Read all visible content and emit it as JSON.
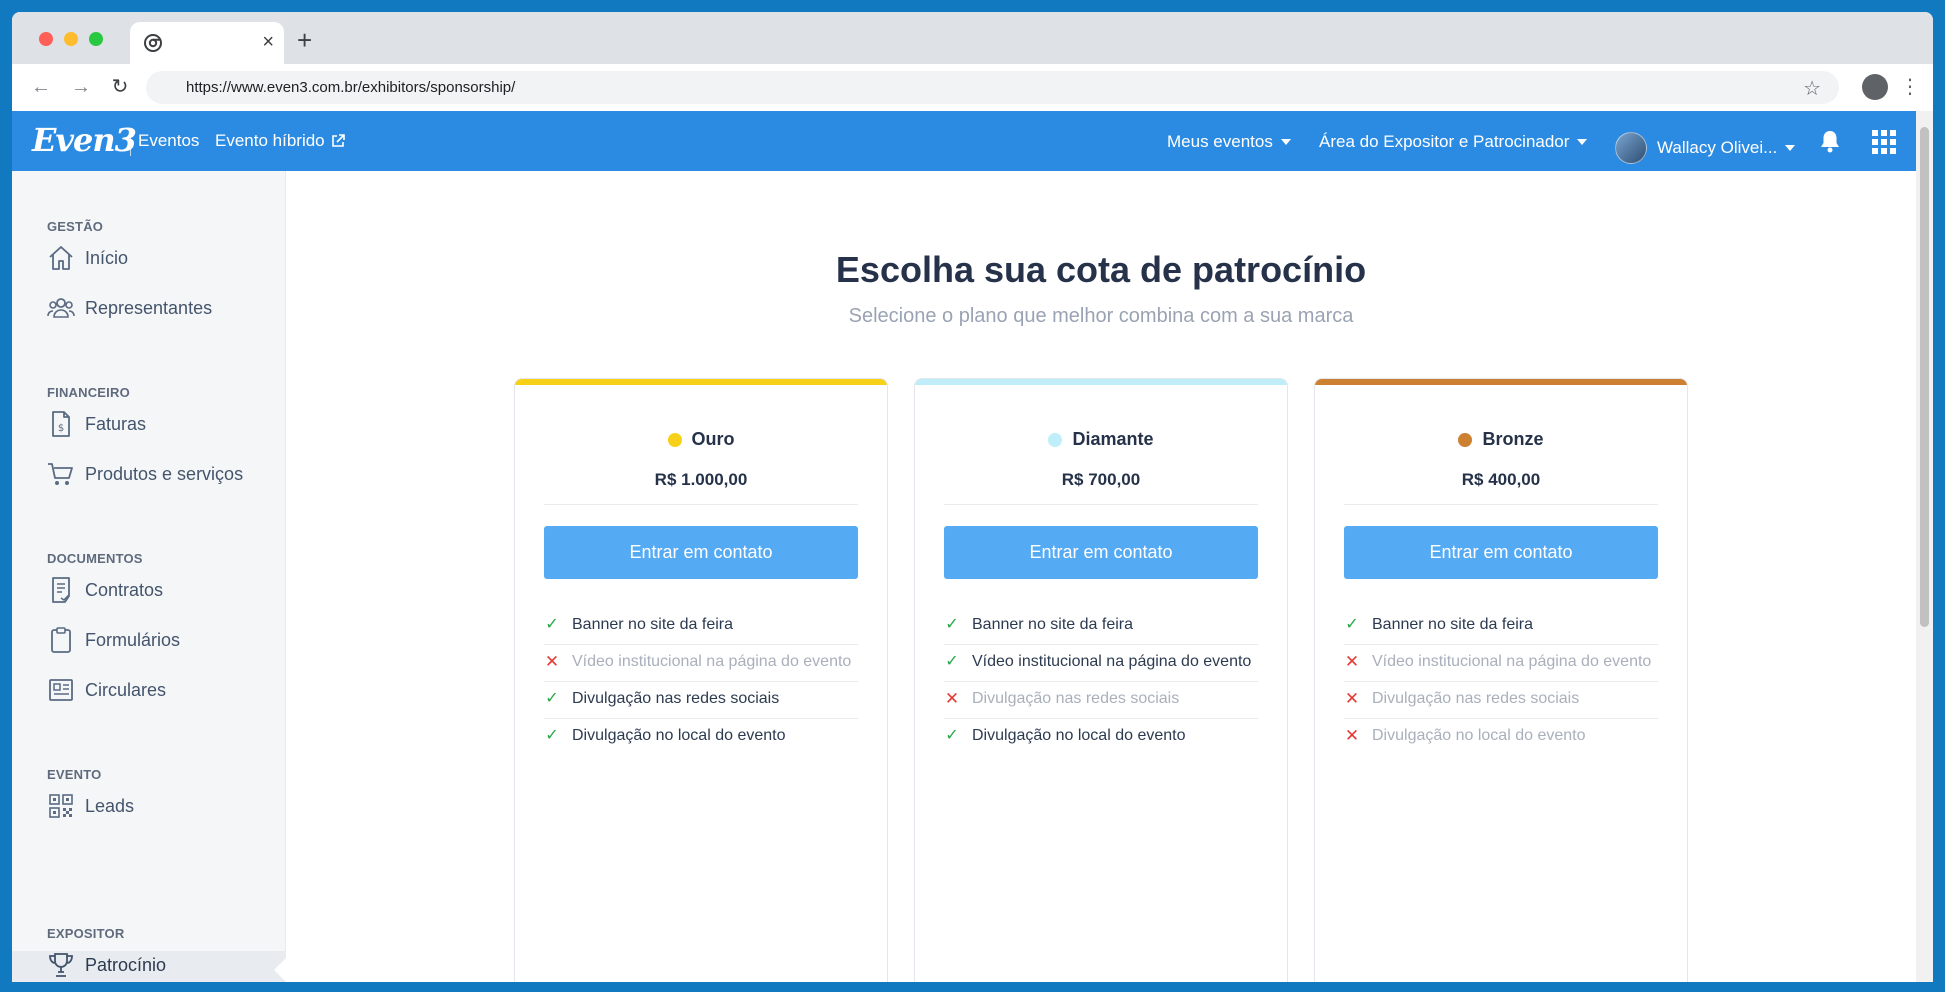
{
  "browser": {
    "url": "https://www.even3.com.br/exhibitors/sponsorship/",
    "tab_close": "×",
    "new_tab": "+"
  },
  "header": {
    "logo": "Even3",
    "brand_sub": "Eventos",
    "hybrid_link": "Evento híbrido",
    "menu_events": "Meus eventos",
    "menu_expo": "Área do Expositor e Patrocinador",
    "user_name": "Wallacy Olivei...",
    "brand_color": "#2b8be3"
  },
  "sidebar": {
    "sections": [
      {
        "title": "GESTÃO",
        "items": [
          {
            "label": "Início",
            "icon": "home-icon"
          },
          {
            "label": "Representantes",
            "icon": "users-icon"
          }
        ]
      },
      {
        "title": "FINANCEIRO",
        "items": [
          {
            "label": "Faturas",
            "icon": "invoice-icon"
          },
          {
            "label": "Produtos e serviços",
            "icon": "cart-icon"
          }
        ]
      },
      {
        "title": "DOCUMENTOS",
        "items": [
          {
            "label": "Contratos",
            "icon": "contract-icon"
          },
          {
            "label": "Formulários",
            "icon": "clipboard-icon"
          },
          {
            "label": "Circulares",
            "icon": "newspaper-icon"
          }
        ]
      },
      {
        "title": "EVENTO",
        "items": [
          {
            "label": "Leads",
            "icon": "qrcode-icon"
          }
        ]
      },
      {
        "title": "EXPOSITOR",
        "items": [
          {
            "label": "Patrocínio",
            "icon": "trophy-icon",
            "active": true
          }
        ]
      }
    ]
  },
  "main": {
    "title": "Escolha sua cota de patrocínio",
    "subtitle": "Selecione o plano que melhor combina com a sua marca",
    "plans": [
      {
        "name": "Ouro",
        "price": "R$ 1.000,00",
        "color": "#f7d117",
        "cta": "Entrar em contato",
        "features": [
          {
            "text": "Banner no site da feira",
            "included": true
          },
          {
            "text": "Vídeo institucional na página do evento",
            "included": false
          },
          {
            "text": "Divulgação nas redes sociais",
            "included": true
          },
          {
            "text": "Divulgação no local do evento",
            "included": true
          }
        ]
      },
      {
        "name": "Diamante",
        "price": "R$ 700,00",
        "color": "#bfeef8",
        "cta": "Entrar em contato",
        "features": [
          {
            "text": "Banner no site da feira",
            "included": true
          },
          {
            "text": "Vídeo institucional na página do evento",
            "included": true
          },
          {
            "text": "Divulgação nas redes sociais",
            "included": false
          },
          {
            "text": "Divulgação no local do evento",
            "included": true
          }
        ]
      },
      {
        "name": "Bronze",
        "price": "R$ 400,00",
        "color": "#cd7f32",
        "cta": "Entrar em contato",
        "features": [
          {
            "text": "Banner no site da feira",
            "included": true
          },
          {
            "text": "Vídeo institucional na página do evento",
            "included": false
          },
          {
            "text": "Divulgação nas redes sociais",
            "included": false
          },
          {
            "text": "Divulgação no local do evento",
            "included": false
          }
        ]
      }
    ]
  }
}
